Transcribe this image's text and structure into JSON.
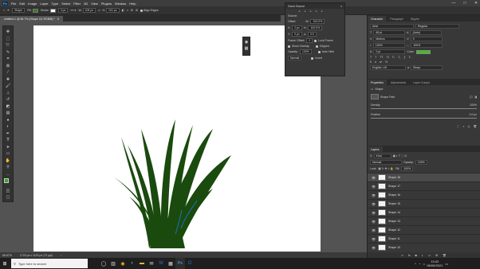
{
  "menu": {
    "items": [
      "File",
      "Edit",
      "Image",
      "Layer",
      "Type",
      "Select",
      "Filter",
      "3D",
      "View",
      "Plugins",
      "Window",
      "Help"
    ]
  },
  "window_controls": {
    "minimize": "—",
    "maximize": "□",
    "close": "✕"
  },
  "options": {
    "mode_label": "Shape",
    "fill_label": "Fill:",
    "stroke_label": "Stroke:",
    "stroke_width": "3 px",
    "w_label": "W:",
    "w_value": "105 px",
    "h_label": "H:",
    "h_value": "101 px",
    "align_edges": "Align Edges",
    "fill_color": "#3b7d1a"
  },
  "document": {
    "tab_label": "Untitled-1 @ 66.7% (Shape 18, RGB/8) *"
  },
  "status": {
    "zoom": "66.67%",
    "doc_info": "1720 px x 1120 px (72 ppi)"
  },
  "clone_panel": {
    "title": "Clone Source",
    "source_label": "Source:",
    "offset_label": "Offset:",
    "x_label": "X:",
    "x_value": "0 px",
    "y_label": "Y:",
    "y_value": "0 px",
    "w_label": "W:",
    "w_value": "100.0%",
    "h_label": "H:",
    "h_value": "100.0%",
    "angle_value": "0.0",
    "frame_offset_label": "Frame Offset:",
    "frame_offset": "0",
    "lock_frame": "Lock Frame",
    "show_overlay": "Show Overlay",
    "opacity_label": "Opacity:",
    "opacity_value": "100%",
    "blend_value": "Normal",
    "clipped": "Clipped",
    "auto_hide": "Auto Hide",
    "invert": "Invert"
  },
  "char_panel": {
    "tabs": [
      "Character",
      "Paragraph",
      "Glyphs"
    ],
    "font_family": "Arial",
    "font_style": "Regular",
    "font_size": "48 pt",
    "leading": "(Auto)",
    "kerning": "Metrics",
    "tracking": "0",
    "vscale": "100%",
    "hscale": "100%",
    "baseline": "0 pt",
    "color_label": "Color:",
    "text_color": "#3fbf1e",
    "language": "English: UK",
    "aa_label": "a",
    "aa_value": "Sharp"
  },
  "properties_panel": {
    "tabs": [
      "Properties",
      "Adjustments",
      "Layer Comps"
    ],
    "kind": "Shape",
    "layer_label": "Shape Path",
    "density_label": "Density",
    "density_value": "100%",
    "feather_label": "Feather",
    "feather_value": "0.0 px"
  },
  "layers_panel": {
    "tab": "Layers",
    "kind_label": "Kind",
    "blend": "Normal",
    "opacity_label": "Opacity:",
    "opacity": "100%",
    "lock_label": "Lock:",
    "fill_label": "Fill:",
    "fill": "100%",
    "layers": [
      "Shape 18",
      "Shape 17",
      "Shape 16",
      "Shape 15",
      "Shape 14",
      "Shape 13",
      "Shape 12",
      "Shape 11",
      "Shape 10"
    ]
  },
  "taskbar": {
    "search_placeholder": "Type here to search",
    "time": "13:42",
    "date": "08/05/2021"
  }
}
